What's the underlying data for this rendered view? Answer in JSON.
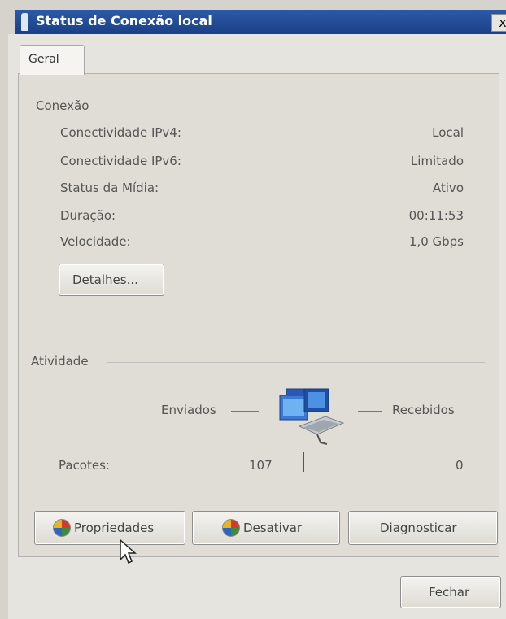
{
  "window": {
    "title": "Status de Conexão local",
    "close_label": "x"
  },
  "tab": {
    "label": "Geral"
  },
  "connection": {
    "group_label": "Conexão",
    "rows": [
      {
        "label": "Conectividade IPv4:",
        "value": "Local"
      },
      {
        "label": "Conectividade IPv6:",
        "value": "Limitado"
      },
      {
        "label": "Status da Mídia:",
        "value": "Ativo"
      },
      {
        "label": "Duração:",
        "value": "00:11:53"
      },
      {
        "label": "Velocidade:",
        "value": "1,0 Gbps"
      }
    ],
    "details_button": "Detalhes..."
  },
  "activity": {
    "group_label": "Atividade",
    "sent_label": "Enviados",
    "received_label": "Recebidos",
    "packets_label": "Pacotes:",
    "packets_sent": "107",
    "packets_received": "0"
  },
  "buttons": {
    "properties": "Propriedades",
    "disable": "Desativar",
    "diagnose": "Diagnosticar",
    "close": "Fechar"
  },
  "icons": {
    "title_icon": "network-adapter-icon",
    "network_icon": "network-computers-icon",
    "shield_icon": "uac-shield-icon",
    "cursor_icon": "mouse-pointer-icon"
  },
  "colors": {
    "title_bar": "#2c5aa8",
    "dialog_bg": "#e6e4df"
  }
}
